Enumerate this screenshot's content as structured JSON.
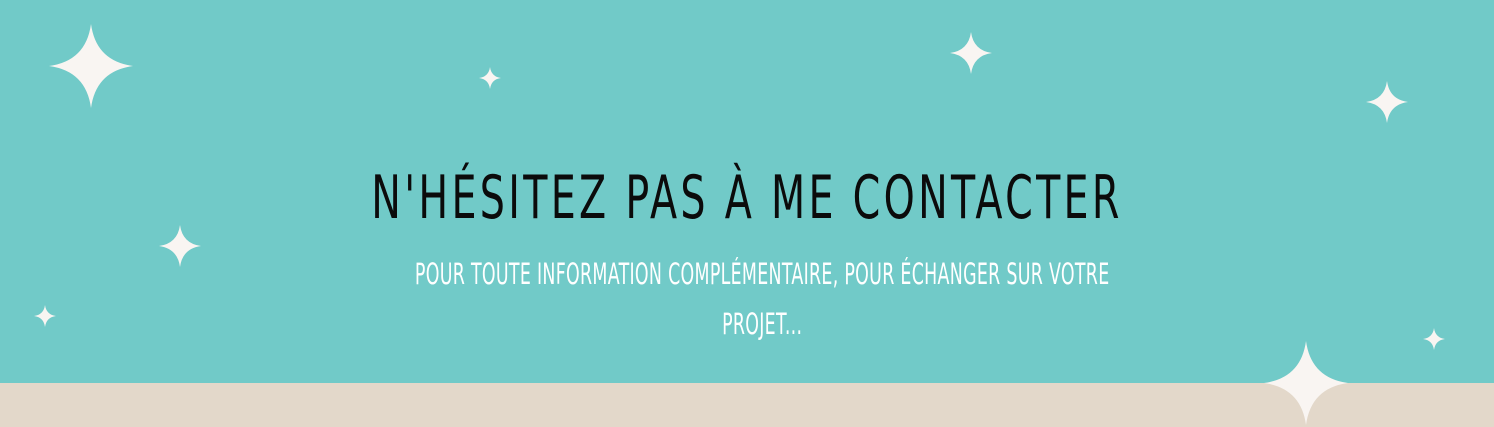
{
  "banner": {
    "background_color": "#71cac8",
    "footer_color": "#e3d8ca",
    "sparkle_color": "#f9f5f2",
    "title": "N'HÉSITEZ PAS À ME CONTACTER",
    "subtitle_line1": "POUR TOUTE INFORMATION COMPLÉMENTAIRE, POUR ÉCHANGER SUR VOTRE",
    "subtitle_line2": "PROJET...",
    "decoration_icon": "four-point-sparkle-icon"
  }
}
